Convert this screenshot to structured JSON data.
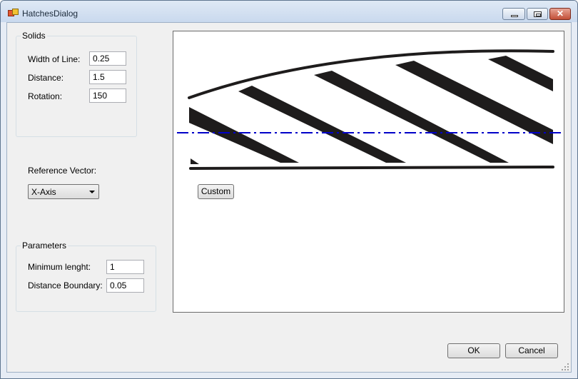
{
  "window": {
    "title": "HatchesDialog"
  },
  "solids": {
    "group_label": "Solids",
    "width_label": "Width of Line:",
    "width_value": "0.25",
    "distance_label": "Distance:",
    "distance_value": "1.5",
    "rotation_label": "Rotation:",
    "rotation_value": "150"
  },
  "reference": {
    "label": "Reference Vector:",
    "selected": "X-Axis"
  },
  "parameters": {
    "group_label": "Parameters",
    "min_length_label": "Minimum lenght:",
    "min_length_value": "1",
    "distance_boundary_label": "Distance Boundary:",
    "distance_boundary_value": "0.05"
  },
  "preview": {
    "custom_label": "Custom"
  },
  "buttons": {
    "ok_label": "OK",
    "cancel_label": "Cancel"
  },
  "colors": {
    "reference_axis": "#0000c8",
    "hatch_fill": "#1e1c1c"
  }
}
